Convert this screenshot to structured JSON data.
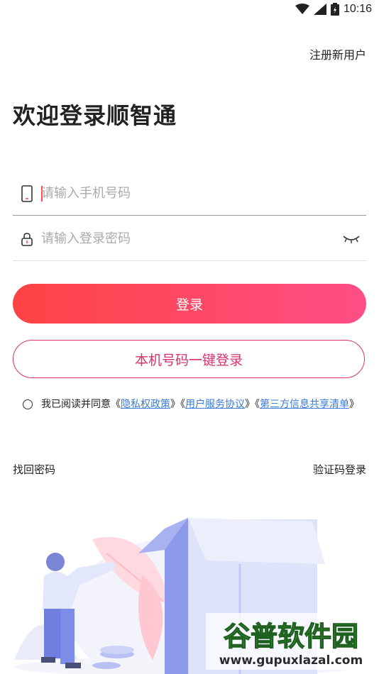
{
  "status_bar": {
    "time": "10:16",
    "icons": [
      "wifi-icon",
      "cellular-signal-icon",
      "battery-icon"
    ]
  },
  "header": {
    "register_link": "注册新用户"
  },
  "welcome_title": "欢迎登录顺智通",
  "form": {
    "phone": {
      "placeholder": "请输入手机号码",
      "value": "",
      "icon": "phone-icon"
    },
    "password": {
      "placeholder": "请输入登录密码",
      "value": "",
      "icon": "lock-icon",
      "toggle_icon": "eye-closed-icon"
    }
  },
  "buttons": {
    "login": "登录",
    "one_key_login": "本机号码一键登录"
  },
  "agreement": {
    "prefix": "我已阅读并同意",
    "open_bracket_1": "《",
    "privacy_policy": "隐私权政策",
    "close_bracket_1": "》",
    "open_bracket_2": "《",
    "user_agreement": "用户服务协议",
    "close_bracket_2": "》",
    "open_bracket_3": "《",
    "third_party_list": "第三方信息共享清单",
    "close_bracket_3": "》"
  },
  "links": {
    "forgot_password": "找回密码",
    "sms_login": "验证码登录"
  },
  "watermark": {
    "title": "谷普软件园",
    "url": "www.gupuxlazal.com"
  },
  "colors": {
    "accent_start": "#ff4343",
    "accent_end": "#ff4e86",
    "outline_accent": "#d6336c",
    "link": "#3a7bd5",
    "watermark_green": "#3aa63a"
  }
}
